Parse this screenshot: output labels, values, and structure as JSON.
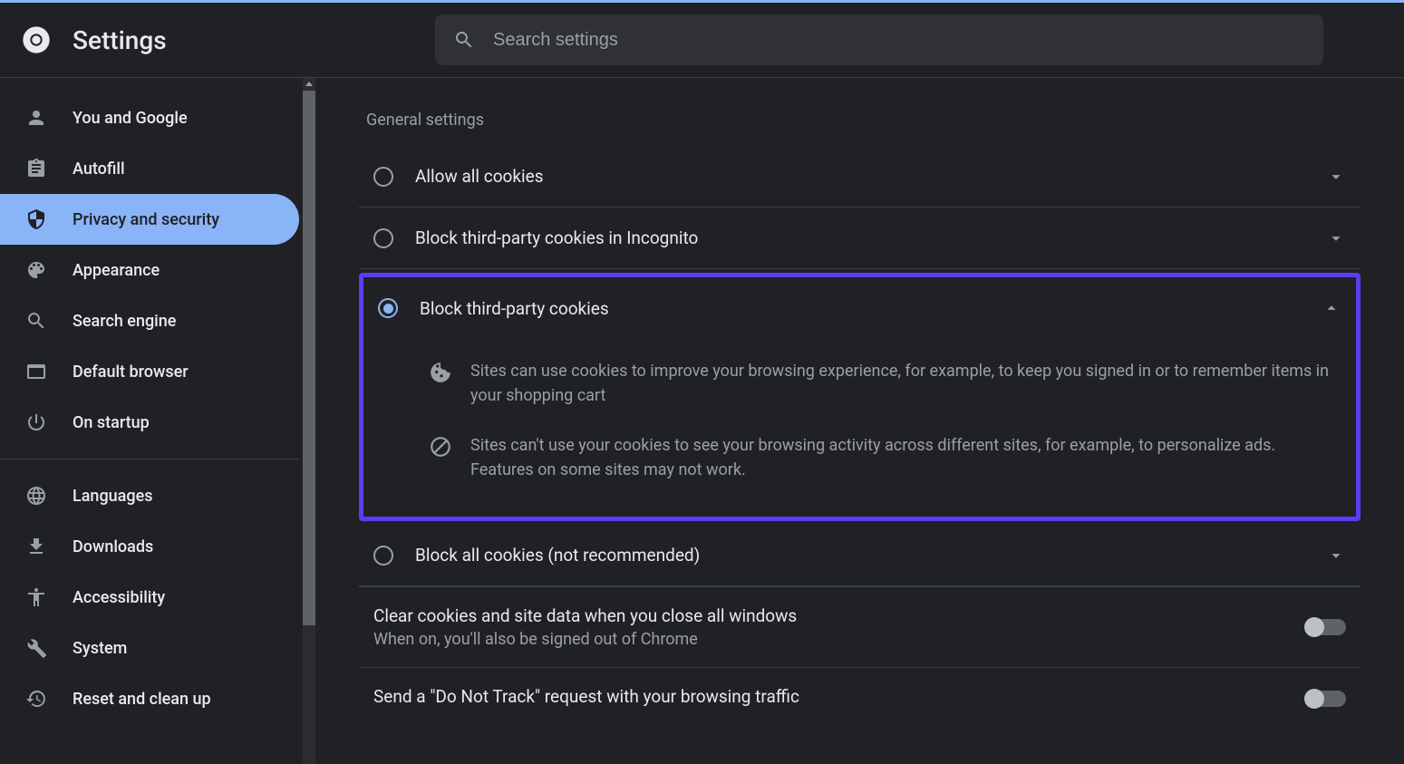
{
  "header": {
    "title": "Settings",
    "search_placeholder": "Search settings"
  },
  "sidebar": {
    "items": [
      {
        "label": "You and Google",
        "icon": "person"
      },
      {
        "label": "Autofill",
        "icon": "clipboard"
      },
      {
        "label": "Privacy and security",
        "icon": "shield",
        "active": true
      },
      {
        "label": "Appearance",
        "icon": "palette"
      },
      {
        "label": "Search engine",
        "icon": "search"
      },
      {
        "label": "Default browser",
        "icon": "browser"
      },
      {
        "label": "On startup",
        "icon": "power"
      }
    ],
    "items2": [
      {
        "label": "Languages",
        "icon": "globe"
      },
      {
        "label": "Downloads",
        "icon": "download"
      },
      {
        "label": "Accessibility",
        "icon": "accessibility"
      },
      {
        "label": "System",
        "icon": "wrench"
      },
      {
        "label": "Reset and clean up",
        "icon": "restore"
      }
    ]
  },
  "content": {
    "section_label": "General settings",
    "options": [
      {
        "label": "Allow all cookies"
      },
      {
        "label": "Block third-party cookies in Incognito"
      },
      {
        "label": "Block third-party cookies",
        "selected": true,
        "detail1": "Sites can use cookies to improve your browsing experience, for example, to keep you signed in or to remember items in your shopping cart",
        "detail2": "Sites can't use your cookies to see your browsing activity across different sites, for example, to personalize ads. Features on some sites may not work."
      },
      {
        "label": "Block all cookies (not recommended)"
      }
    ],
    "settings": [
      {
        "title": "Clear cookies and site data when you close all windows",
        "desc": "When on, you'll also be signed out of Chrome"
      },
      {
        "title": "Send a \"Do Not Track\" request with your browsing traffic"
      }
    ]
  }
}
